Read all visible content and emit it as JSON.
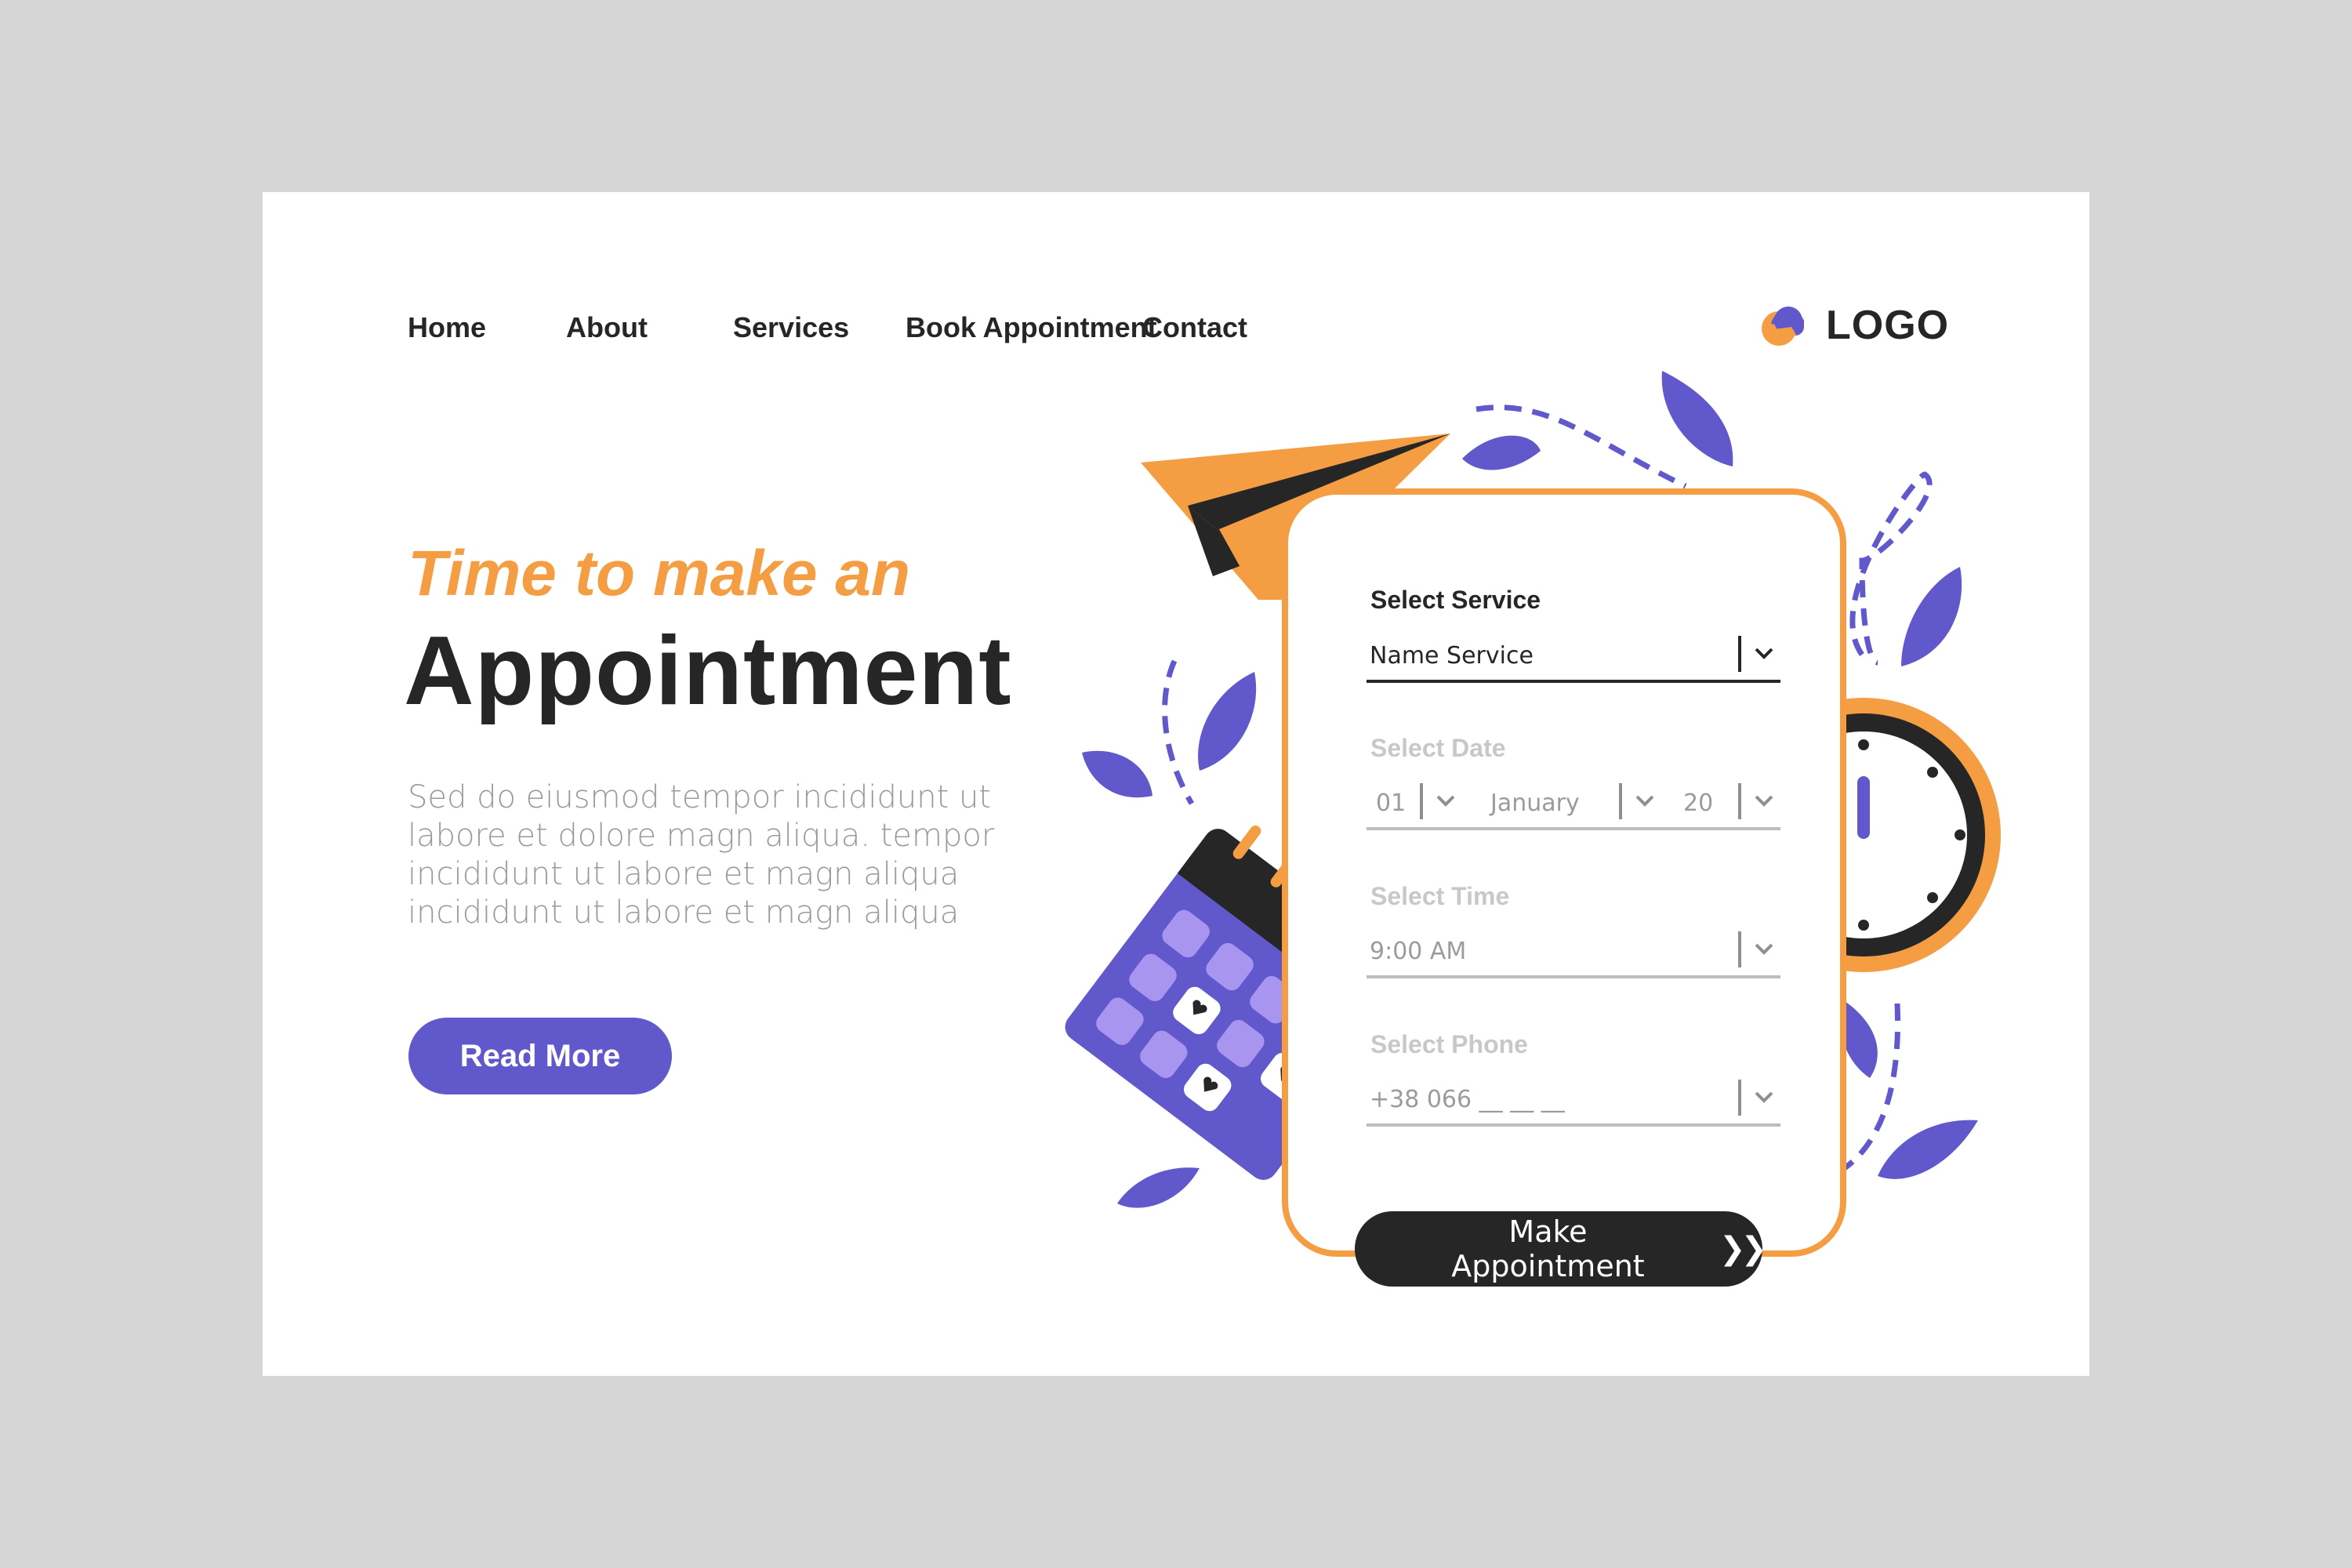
{
  "nav": {
    "items": [
      "Home",
      "About",
      "Services",
      "Book Appointment",
      "Contact"
    ]
  },
  "logo": {
    "text": "LOGO"
  },
  "hero": {
    "tagline": "Time to make an",
    "headline": "Appointment",
    "body": "Sed do eiusmod tempor incididunt ut labore et dolore magn aliqua. tempor incididunt ut labore et  magn aliqua incididunt ut labore et  magn aliqua",
    "read_more_label": "Read More"
  },
  "form": {
    "service": {
      "label": "Select Service",
      "value": "Name Service"
    },
    "date": {
      "label": "Select Date",
      "day": "01",
      "month": "January",
      "year": "20"
    },
    "time": {
      "label": "Select Time",
      "value": "9:00  AM"
    },
    "phone": {
      "label": "Select Phone",
      "value": "+38  066  __ __ __"
    },
    "submit_label": "Make Appointment",
    "submit_icon": "double-chevron-right-icon"
  },
  "colors": {
    "accent_orange": "#f49d43",
    "accent_purple": "#6158cc",
    "dark": "#262626",
    "page_bg": "#d6d6d6"
  }
}
